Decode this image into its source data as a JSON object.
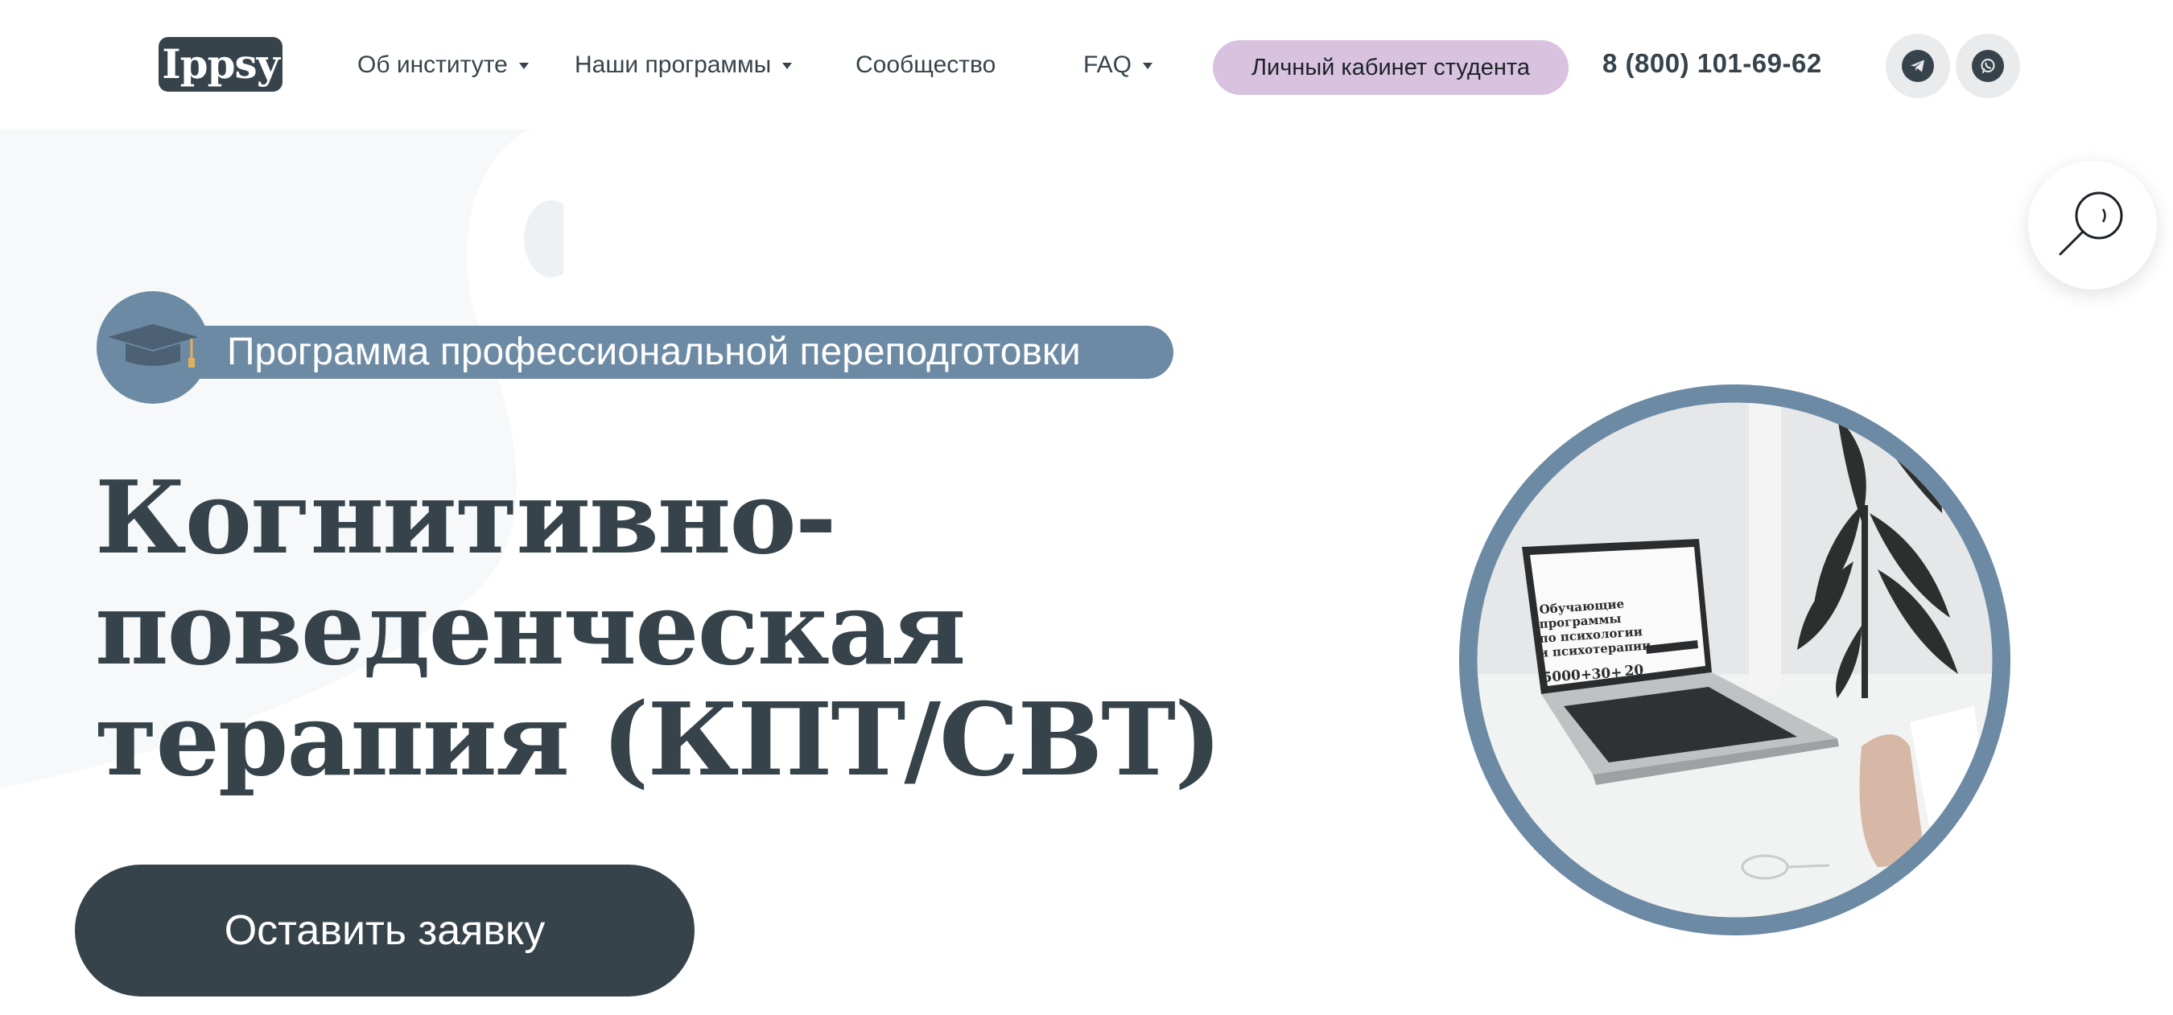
{
  "header": {
    "logo_text": "Ippsy",
    "nav": [
      {
        "label": "Об институте",
        "has_dropdown": true
      },
      {
        "label": "Наши программы",
        "has_dropdown": true
      },
      {
        "label": "Сообщество",
        "has_dropdown": false
      },
      {
        "label": "FAQ",
        "has_dropdown": true
      }
    ],
    "cabinet_label": "Личный кабинет студента",
    "phone": "8 (800) 101-69-62",
    "socials": [
      "telegram-icon",
      "whatsapp-icon"
    ]
  },
  "hero": {
    "badge_label": "Программа профессиональной переподготовки",
    "badge_icon": "graduation-cap-icon",
    "title_lines": [
      "Когнитивно-",
      "поведенческая",
      "терапия (КПТ/CBT)"
    ],
    "cta_label": "Оставить заявку"
  },
  "laptop_screen": {
    "heading_lines": [
      "Обучающие",
      "программы",
      "по психологии",
      "и психотерапии"
    ],
    "stats": [
      "5000+",
      "30+",
      "20"
    ]
  },
  "colors": {
    "text_dark": "#37434b",
    "accent_blue": "#6d8aa5",
    "cabinet_bg": "#d8c2e0",
    "social_bg": "#e9ebed"
  }
}
